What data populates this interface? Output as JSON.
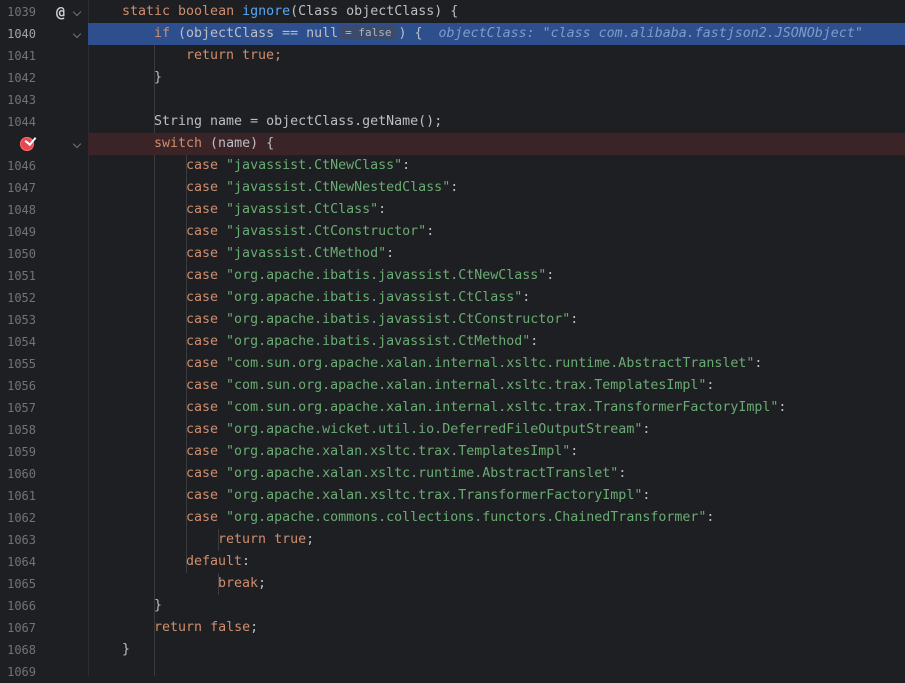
{
  "method_signature": {
    "modifiers": "static boolean",
    "name": "ignore",
    "params": "(Class objectClass) {"
  },
  "if_line": {
    "kw": "if",
    "expr": " (objectClass == null",
    "inlay_value": "= false",
    "close": ") {",
    "debug_inline": "objectClass: \"class com.alibaba.fastjson2.JSONObject\""
  },
  "return_true_line": "return true;",
  "close_brace_1": "}",
  "assignment_line": "String name = objectClass.getName();",
  "switch_line": {
    "kw": "switch",
    "rest": " (name) {"
  },
  "cases": [
    "\"javassist.CtNewClass\"",
    "\"javassist.CtNewNestedClass\"",
    "\"javassist.CtClass\"",
    "\"javassist.CtConstructor\"",
    "\"javassist.CtMethod\"",
    "\"org.apache.ibatis.javassist.CtNewClass\"",
    "\"org.apache.ibatis.javassist.CtClass\"",
    "\"org.apache.ibatis.javassist.CtConstructor\"",
    "\"org.apache.ibatis.javassist.CtMethod\"",
    "\"com.sun.org.apache.xalan.internal.xsltc.runtime.AbstractTranslet\"",
    "\"com.sun.org.apache.xalan.internal.xsltc.trax.TemplatesImpl\"",
    "\"com.sun.org.apache.xalan.internal.xsltc.trax.TransformerFactoryImpl\"",
    "\"org.apache.wicket.util.io.DeferredFileOutputStream\"",
    "\"org.apache.xalan.xsltc.trax.TemplatesImpl\"",
    "\"org.apache.xalan.xsltc.runtime.AbstractTranslet\"",
    "\"org.apache.xalan.xsltc.trax.TransformerFactoryImpl\"",
    "\"org.apache.commons.collections.functors.ChainedTransformer\""
  ],
  "case_kw": "case",
  "case_colon": ":",
  "return_true_inner": {
    "kw": "return",
    "val": "true",
    "end": ";"
  },
  "default_line": {
    "kw": "default",
    "end": ":"
  },
  "break_line": {
    "kw": "break",
    "end": ";"
  },
  "close_brace_switch": "}",
  "return_false_line": {
    "kw": "return",
    "val": "false",
    "end": ";"
  },
  "close_brace_method": "}",
  "line_numbers": [
    "1039",
    "1040",
    "1041",
    "1042",
    "1043",
    "1044",
    "",
    "1046",
    "1047",
    "1048",
    "1049",
    "1050",
    "1051",
    "1052",
    "1053",
    "1054",
    "1055",
    "1056",
    "1057",
    "1058",
    "1059",
    "1060",
    "1061",
    "1062",
    "1063",
    "1064",
    "1065",
    "1066",
    "1067",
    "1068",
    "1069"
  ],
  "colors": {
    "background": "#1e1f22",
    "keyword": "#cf8e6d",
    "string": "#6aab73",
    "method": "#56a8f5",
    "text": "#bcbec4",
    "exec_highlight": "#2d4f8e",
    "breakpoint_line": "#3b2427",
    "breakpoint": "#e5484d"
  }
}
